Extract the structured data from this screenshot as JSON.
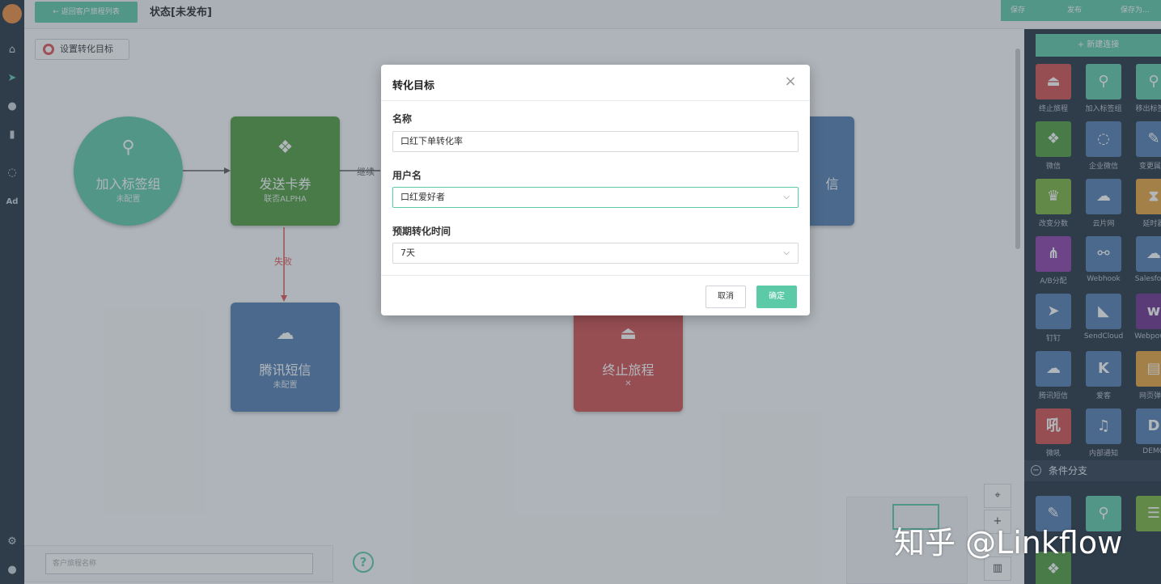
{
  "topbar": {
    "back_label": "← 返回客户旅程列表",
    "status_title": "状态[未发布]",
    "actions": [
      "保存",
      "发布",
      "保存为..."
    ]
  },
  "leftnav": {
    "items": [
      "home-icon",
      "send-icon",
      "user-icon",
      "chart-icon",
      "chat-icon",
      "ad-icon",
      "gear-icon",
      "avatar"
    ],
    "ad_label": "Ad"
  },
  "canvas": {
    "goal_button": "设置转化目标",
    "nodes": [
      {
        "title": "加入标签组",
        "subtitle": "未配置",
        "icon": "user-plus-icon",
        "color": "#5cc9a7"
      },
      {
        "title": "发送卡券",
        "subtitle": "联否ALPHA",
        "icon": "wechat-icon",
        "color": "#4d9a3c"
      },
      {
        "title": "腾讯短信",
        "subtitle": "未配置",
        "icon": "cloud-icon",
        "color": "#4f7bae"
      },
      {
        "title": "终止旅程",
        "subtitle": "",
        "icon": "eject-icon",
        "color": "#d14d4d"
      },
      {
        "title": "信",
        "subtitle": "",
        "icon": "",
        "color": "#4f7bae"
      }
    ],
    "edge_continue": "继续",
    "edge_fail": "失败",
    "bottom_input_placeholder": "客户旅程名称",
    "help": "?"
  },
  "palette": {
    "new_connection": "+ 新建连接",
    "items": [
      {
        "label": "终止旅程",
        "color": "#d14d4d",
        "icon": "eject-icon"
      },
      {
        "label": "加入标签组",
        "color": "#5cc9a7",
        "icon": "user-plus-icon"
      },
      {
        "label": "移出标签组",
        "color": "#5cc9a7",
        "icon": "user-minus-icon"
      },
      {
        "label": "微信",
        "color": "#4d9a3c",
        "icon": "wechat-icon"
      },
      {
        "label": "企业微信",
        "color": "#4f7bae",
        "icon": "chat-icon"
      },
      {
        "label": "变更属性",
        "color": "#4f7bae",
        "icon": "edit-icon"
      },
      {
        "label": "改变分数",
        "color": "#79b23a",
        "icon": "trophy-icon"
      },
      {
        "label": "云片网",
        "color": "#4f7bae",
        "icon": "cloud-link-icon"
      },
      {
        "label": "延时器",
        "color": "#e8a23b",
        "icon": "hourglass-icon"
      },
      {
        "label": "A/B分配",
        "color": "#8a3ca6",
        "icon": "split-icon"
      },
      {
        "label": "Webhook",
        "color": "#4f7bae",
        "icon": "webhook-icon"
      },
      {
        "label": "Salesforce",
        "color": "#4f7bae",
        "icon": "cloud-icon"
      },
      {
        "label": "钉钉",
        "color": "#4f7bae",
        "icon": "dingtalk-icon"
      },
      {
        "label": "SendCloud",
        "color": "#4f7bae",
        "icon": "sendcloud-icon"
      },
      {
        "label": "Webpower",
        "color": "#6a2c8a",
        "icon": "webpower-icon"
      },
      {
        "label": "腾讯短信",
        "color": "#4f7bae",
        "icon": "cloud-icon"
      },
      {
        "label": "爱客",
        "color": "#4f7bae",
        "icon": "k-icon"
      },
      {
        "label": "网页弹窗",
        "color": "#e8a23b",
        "icon": "popup-icon"
      },
      {
        "label": "微吼",
        "color": "#d14d4d",
        "icon": "weihou-icon"
      },
      {
        "label": "内部通知",
        "color": "#4f7bae",
        "icon": "bell-icon"
      },
      {
        "label": "DEMO",
        "color": "#4f7bae",
        "icon": "demo-icon"
      }
    ],
    "condition_header": "条件分支"
  },
  "modal": {
    "title": "转化目标",
    "fields": [
      {
        "label": "名称",
        "value": "口红下单转化率"
      },
      {
        "label": "用户名",
        "value": "口红爱好者"
      },
      {
        "label": "预期转化时间",
        "value": "7天"
      }
    ],
    "cancel": "取消",
    "ok": "确定"
  },
  "watermark": "知乎 @Linkflow"
}
